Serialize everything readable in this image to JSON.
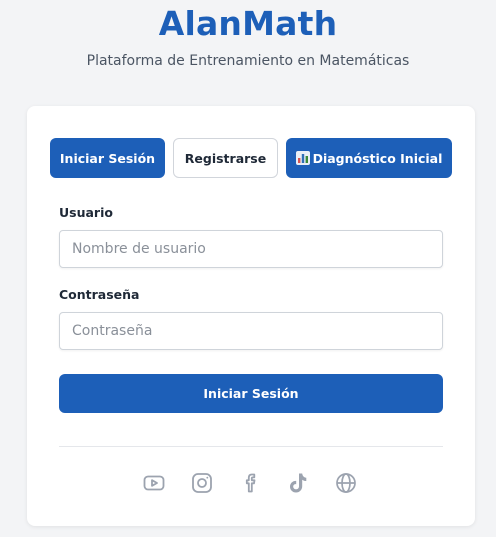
{
  "header": {
    "title": "AlanMath",
    "subtitle": "Plataforma de Entrenamiento en Matemáticas"
  },
  "tabs": {
    "login_label": "Iniciar Sesión",
    "register_label": "Registrarse",
    "diagnostic_label": "Diagnóstico Inicial",
    "diagnostic_icon": "bar-chart-icon"
  },
  "form": {
    "username_label": "Usuario",
    "username_placeholder": "Nombre de usuario",
    "username_value": "",
    "password_label": "Contraseña",
    "password_placeholder": "Contraseña",
    "password_value": "",
    "submit_label": "Iniciar Sesión"
  },
  "social": [
    "youtube-icon",
    "instagram-icon",
    "facebook-icon",
    "tiktok-icon",
    "globe-icon"
  ],
  "colors": {
    "brand": "#1d5fb8",
    "icon_gray": "#9ca3af",
    "background": "#f3f4f6"
  }
}
